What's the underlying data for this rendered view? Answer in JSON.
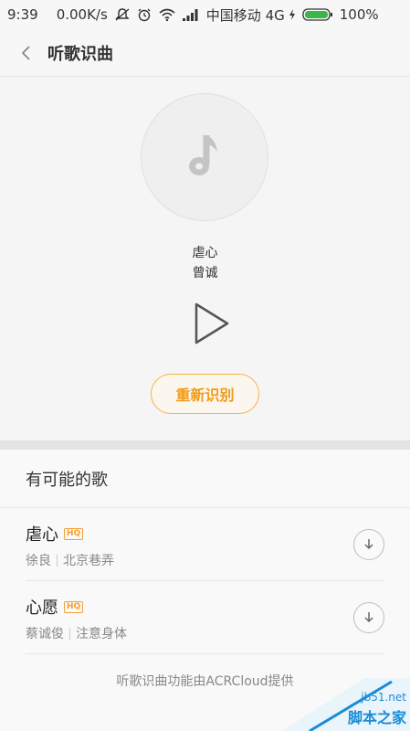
{
  "status_bar": {
    "time": "9:39",
    "speed": "0.00K/s",
    "carrier": "中国移动 4G",
    "battery": "100%"
  },
  "header": {
    "title": "听歌识曲"
  },
  "result": {
    "song": "虐心",
    "artist": "曾诚",
    "rerecognize_label": "重新识别"
  },
  "possible_songs": {
    "heading": "有可能的歌",
    "items": [
      {
        "title": "虐心",
        "badge": "HQ",
        "artist": "徐良",
        "album": "北京巷弄"
      },
      {
        "title": "心愿",
        "badge": "HQ",
        "artist": "蔡诚俊",
        "album": "注意身体"
      }
    ]
  },
  "footer": {
    "note": "听歌识曲功能由ACRCloud提供"
  },
  "watermark": {
    "site": "jb51.net",
    "name": "脚本之家"
  },
  "colors": {
    "accent": "#f29a15",
    "battery": "#3cb54a"
  },
  "icons": [
    "back-chevron-icon",
    "music-note-icon",
    "play-icon",
    "download-icon",
    "wifi-icon",
    "signal-icon",
    "battery-icon",
    "alarm-icon",
    "mute-icon"
  ]
}
